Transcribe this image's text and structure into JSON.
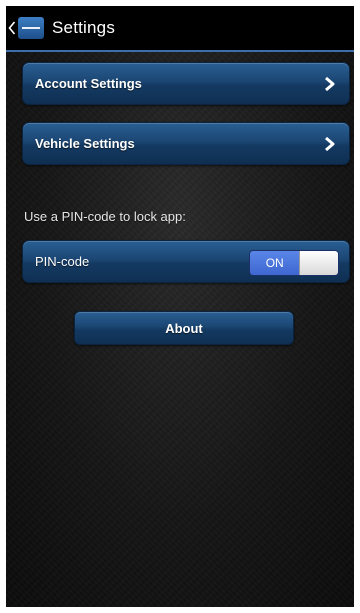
{
  "header": {
    "title": "Settings",
    "back_icon": "chevron-left-icon",
    "app_icon": "app-logo-icon",
    "accent_color": "#3a6fa8"
  },
  "menu": {
    "items": [
      {
        "label": "Account Settings",
        "icon": "chevron-right-icon"
      },
      {
        "label": "Vehicle Settings",
        "icon": "chevron-right-icon"
      }
    ]
  },
  "pin": {
    "section_label": "Use a PIN-code to lock app:",
    "label": "PIN-code",
    "toggle_state": "ON",
    "toggle_on_color": "#4a74dc"
  },
  "about": {
    "label": "About"
  },
  "colors": {
    "row_gradient_top": "#2a5f93",
    "row_gradient_bottom": "#0f2f52",
    "background": "#151515"
  }
}
